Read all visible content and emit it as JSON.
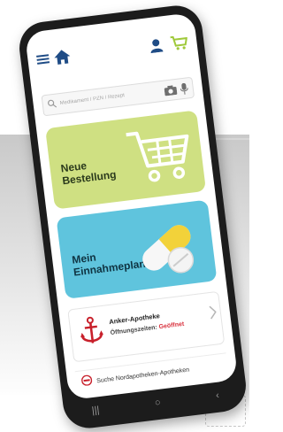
{
  "header": {
    "menu_icon": "hamburger-icon",
    "home_icon": "home-icon",
    "profile_icon": "user-icon",
    "cart_icon": "cart-icon"
  },
  "search": {
    "placeholder": "Medikament / PZN / Rezept",
    "camera_icon": "camera-icon",
    "mic_icon": "microphone-icon"
  },
  "cards": {
    "order": {
      "label_line1": "Neue",
      "label_line2": "Bestellung",
      "color": "#cfe082"
    },
    "plan": {
      "label_line1": "Mein",
      "label_line2": "Einnahmeplan",
      "color": "#5fc4dd"
    }
  },
  "pharmacy": {
    "name": "Anker-Apotheke",
    "hours_label": "Öffnungszeiten:",
    "status": "Geöffnet",
    "status_color": "#d9333f"
  },
  "find": {
    "label": "Suche Nordapotheken-Apotheken"
  },
  "android_nav": {
    "recents": "|||",
    "home": "○",
    "back": "‹"
  }
}
